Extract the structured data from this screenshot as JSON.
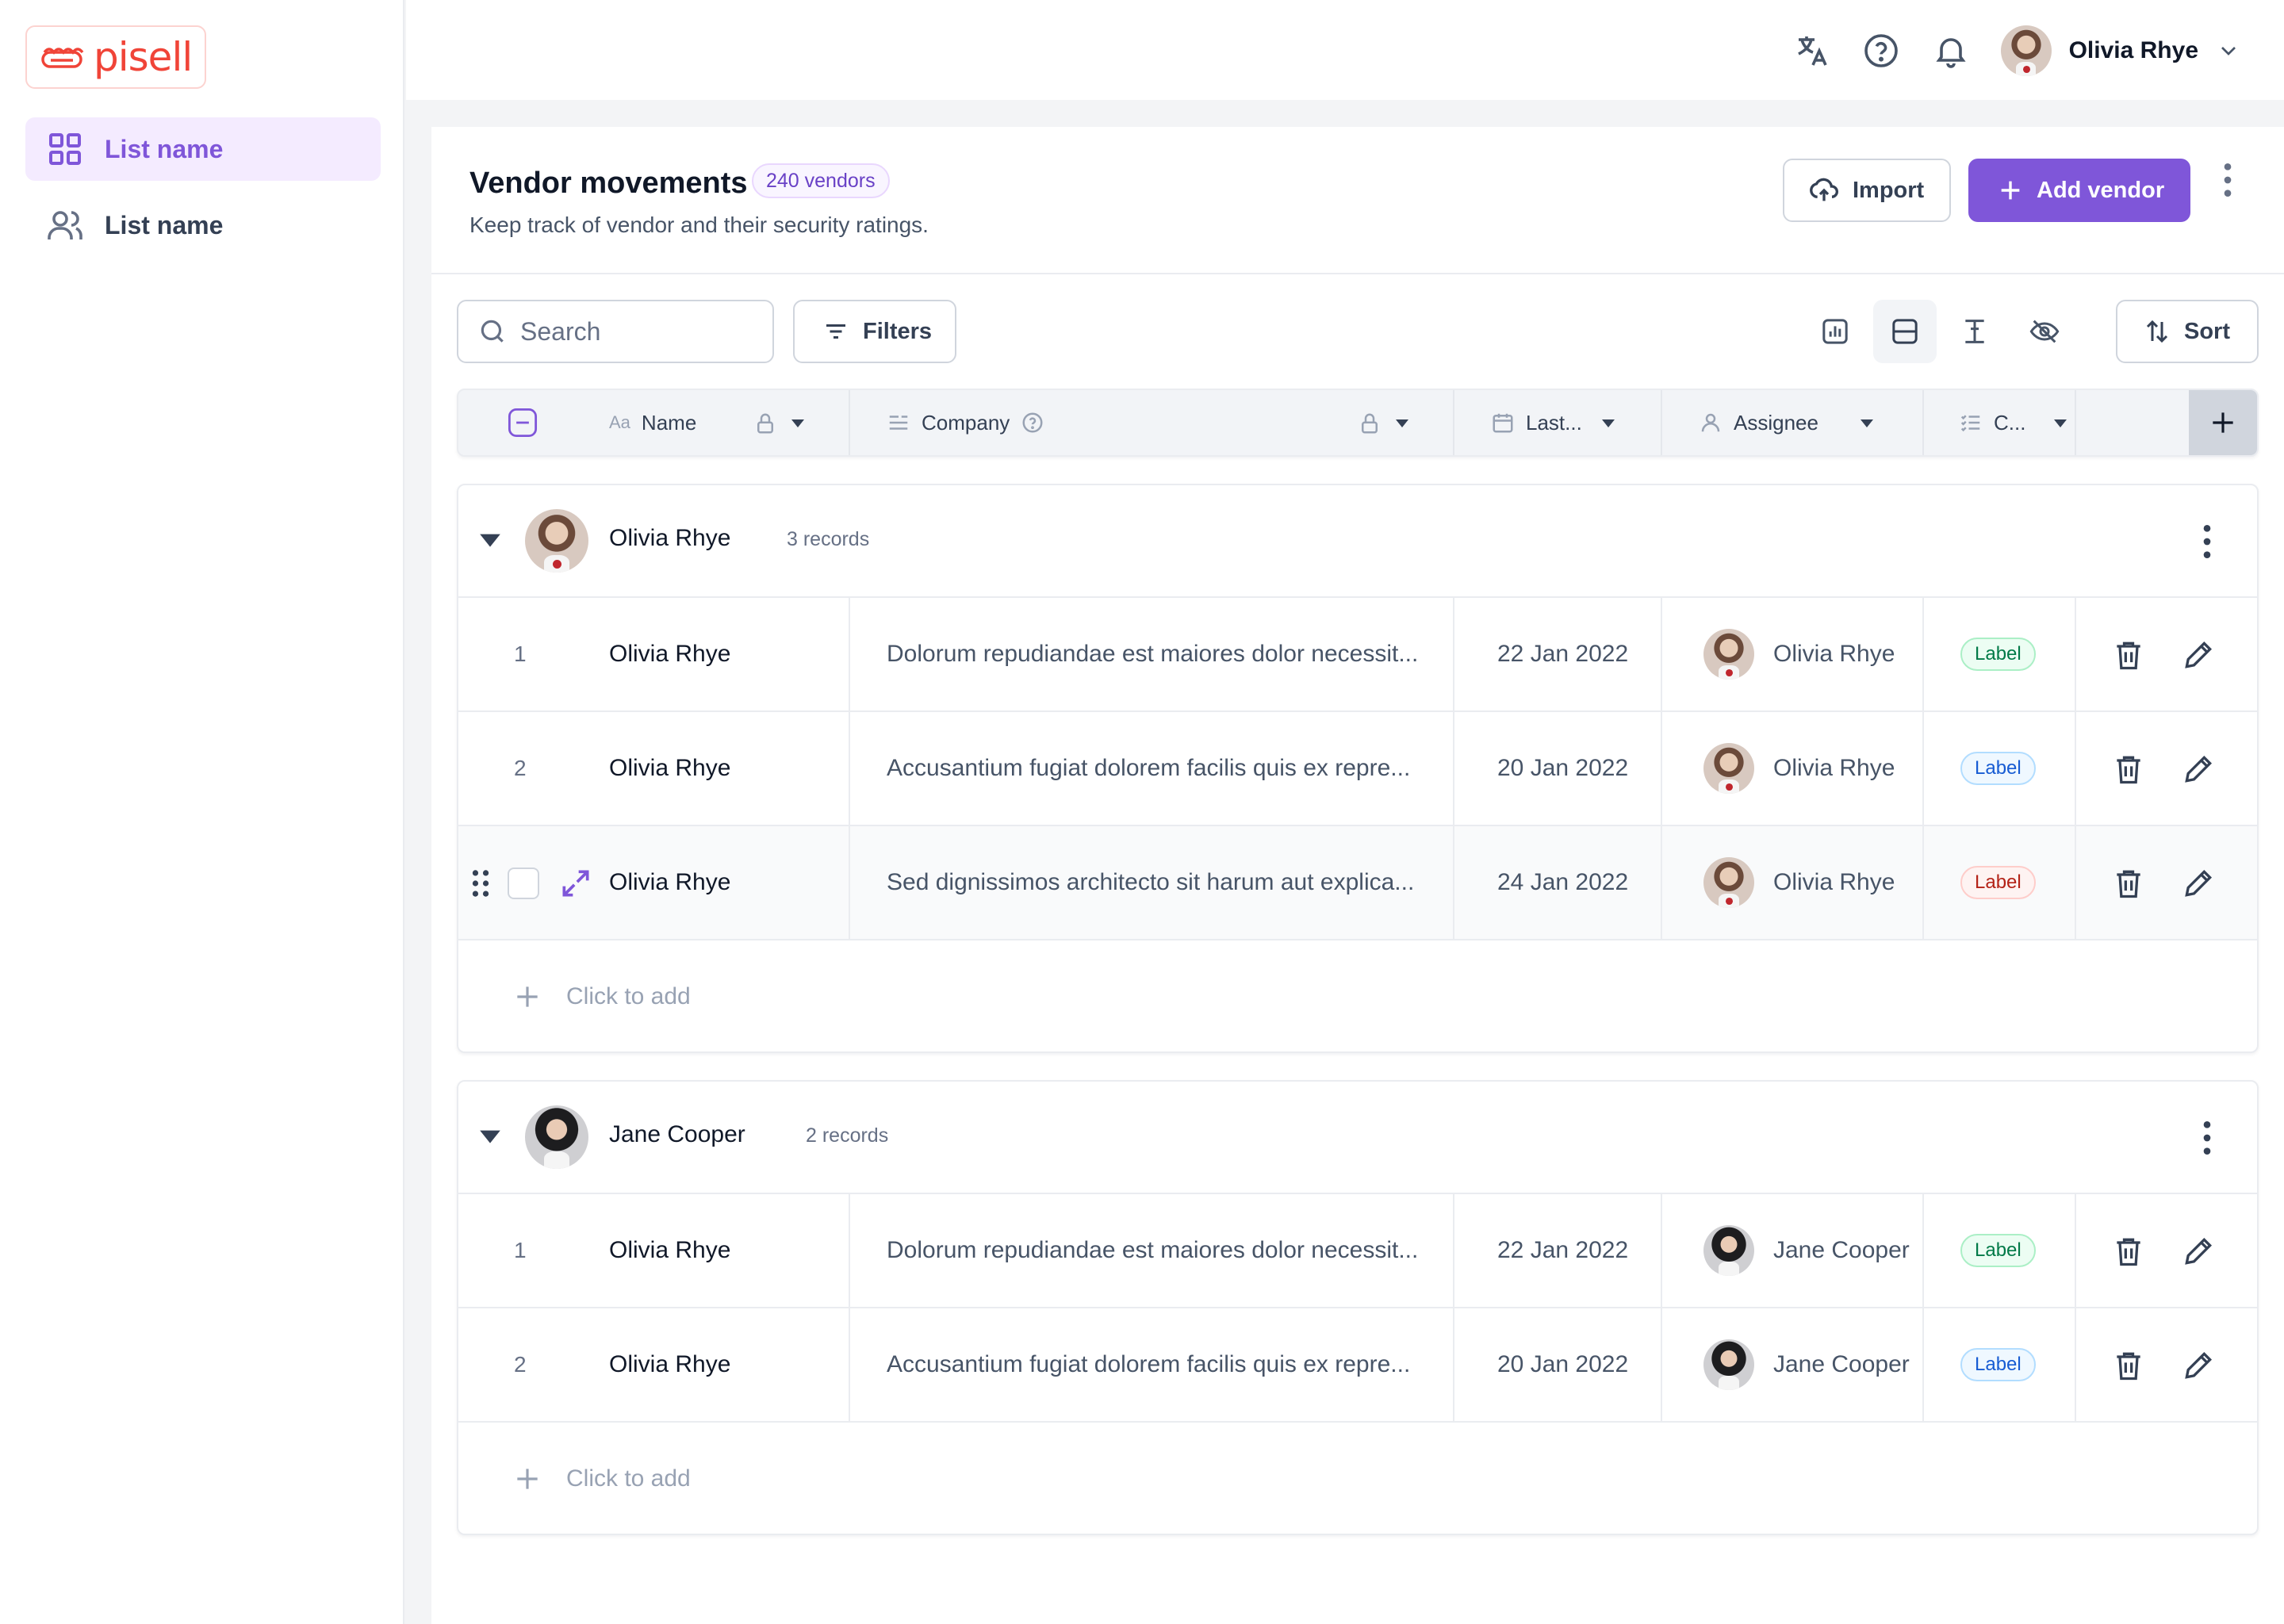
{
  "brand": {
    "logo_text": "pisell",
    "brand_color": "#f04438"
  },
  "sidebar": {
    "items": [
      {
        "label": "List name",
        "icon": "grid-icon",
        "active": true
      },
      {
        "label": "List name",
        "icon": "users-icon",
        "active": false
      }
    ]
  },
  "topbar": {
    "icons": [
      "translate-icon",
      "help-icon",
      "bell-icon"
    ],
    "user_name": "Olivia Rhye"
  },
  "page": {
    "title": "Vendor movements",
    "badge": "240 vendors",
    "subtitle": "Keep track of vendor and their security ratings.",
    "import_label": "Import",
    "add_label": "Add vendor",
    "accent": "#7f56d9"
  },
  "toolbar": {
    "search_placeholder": "Search",
    "filters_label": "Filters",
    "sort_label": "Sort"
  },
  "columns": {
    "name": "Name",
    "company": "Company",
    "last": "Last...",
    "assignee": "Assignee",
    "category": "C..."
  },
  "groups": [
    {
      "name": "Olivia Rhye",
      "count": "3 records",
      "rows": [
        {
          "index": "1",
          "name": "Olivia Rhye",
          "company": "Dolorum repudiandae est maiores dolor necessit...",
          "date": "22 Jan 2022",
          "assignee": "Olivia Rhye",
          "label": "Label",
          "label_color": "green"
        },
        {
          "index": "2",
          "name": "Olivia Rhye",
          "company": "Accusantium fugiat dolorem facilis quis ex repre...",
          "date": "20 Jan 2022",
          "assignee": "Olivia Rhye",
          "label": "Label",
          "label_color": "blue"
        },
        {
          "index": "",
          "name": "Olivia Rhye",
          "company": "Sed dignissimos architecto sit harum aut explica...",
          "date": "24 Jan 2022",
          "assignee": "Olivia Rhye",
          "label": "Label",
          "label_color": "red"
        }
      ],
      "add_label": "Click to add"
    },
    {
      "name": "Jane Cooper",
      "count": "2 records",
      "rows": [
        {
          "index": "1",
          "name": "Olivia Rhye",
          "company": "Dolorum repudiandae est maiores dolor necessit...",
          "date": "22 Jan 2022",
          "assignee": "Jane Cooper",
          "label": "Label",
          "label_color": "green"
        },
        {
          "index": "2",
          "name": "Olivia Rhye",
          "company": "Accusantium fugiat dolorem facilis quis ex repre...",
          "date": "20 Jan 2022",
          "assignee": "Jane Cooper",
          "label": "Label",
          "label_color": "blue"
        }
      ],
      "add_label": "Click to add"
    }
  ]
}
